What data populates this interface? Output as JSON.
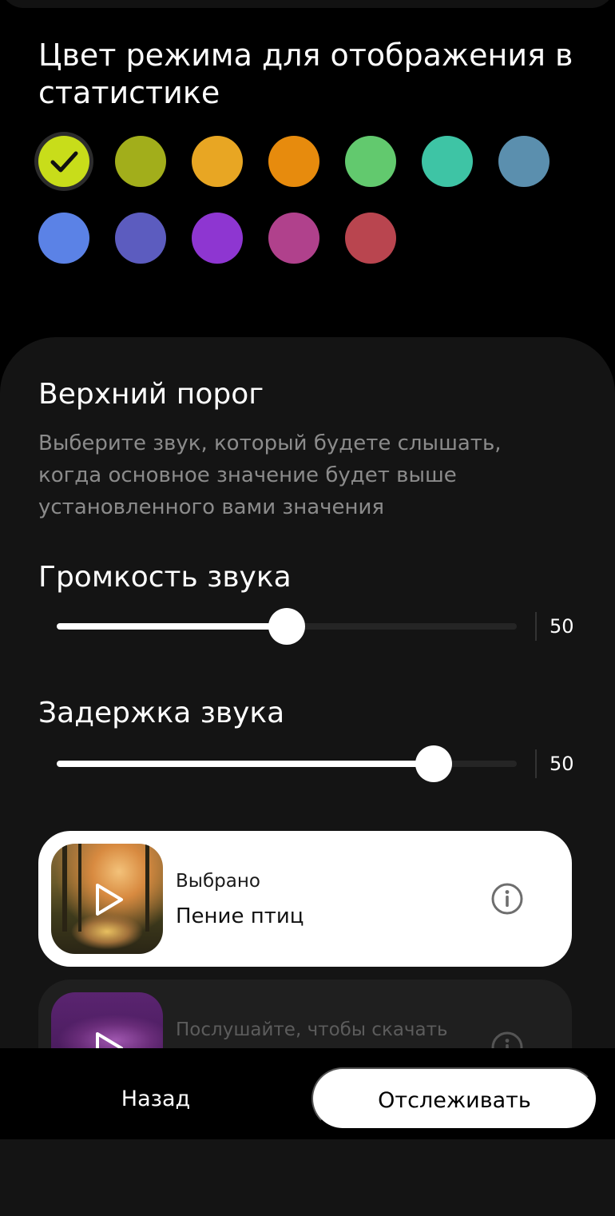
{
  "color_section": {
    "title": "Цвет режима для отображения в статистике",
    "swatches": [
      {
        "color": "#c8dd1a",
        "selected": true
      },
      {
        "color": "#a2ae1b",
        "selected": false
      },
      {
        "color": "#e8a623",
        "selected": false
      },
      {
        "color": "#e78b0d",
        "selected": false
      },
      {
        "color": "#62c96e",
        "selected": false
      },
      {
        "color": "#3ec4a5",
        "selected": false
      },
      {
        "color": "#5b8fae",
        "selected": false
      },
      {
        "color": "#5b82e6",
        "selected": false
      },
      {
        "color": "#5c5cbf",
        "selected": false
      },
      {
        "color": "#8e36d1",
        "selected": false
      },
      {
        "color": "#b0418c",
        "selected": false
      },
      {
        "color": "#b9454f",
        "selected": false
      }
    ]
  },
  "upper_threshold": {
    "title": "Верхний порог",
    "description": "Выберите звук, который будете слышать, когда основное значение будет выше установленного вами значения"
  },
  "volume": {
    "label": "Громкость звука",
    "value": "50",
    "fraction": 0.5
  },
  "delay": {
    "label": "Задержка звука",
    "value": "50",
    "fraction": 0.82
  },
  "sounds": [
    {
      "label": "Выбрано",
      "title": "Пение птиц",
      "icons": [
        "play-icon",
        "info-icon"
      ]
    },
    {
      "label": "Послушайте, чтобы скачать",
      "title": "",
      "icons": [
        "play-icon",
        "info-icon"
      ]
    }
  ],
  "buttons": {
    "back": "Назад",
    "track": "Отслеживать"
  }
}
